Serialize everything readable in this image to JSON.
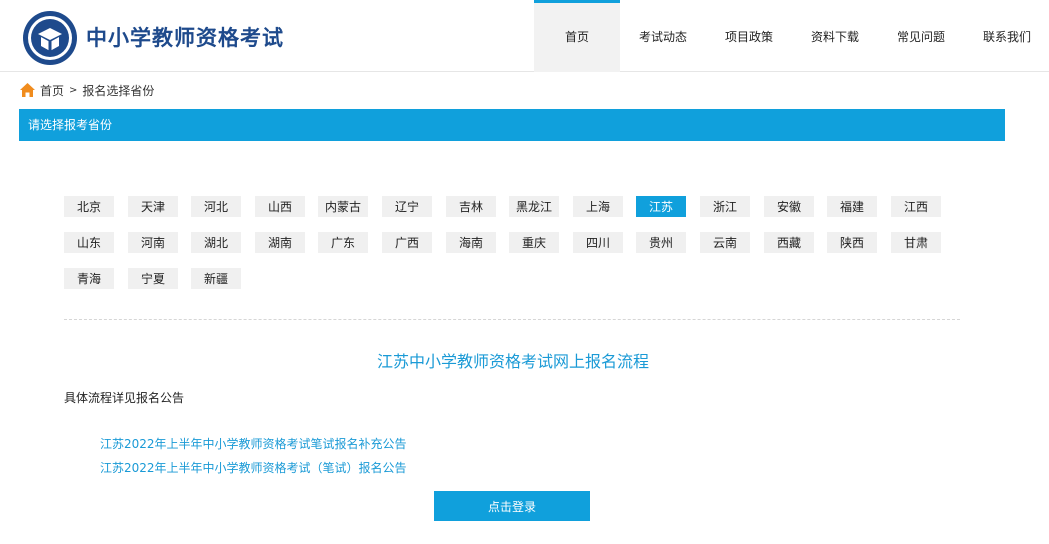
{
  "header": {
    "site_title": "中小学教师资格考试",
    "nav": [
      "首页",
      "考试动态",
      "项目政策",
      "资料下载",
      "常见问题",
      "联系我们"
    ],
    "active_nav": 0
  },
  "breadcrumb": {
    "home_icon": "home-icon",
    "home": "首页",
    "separator": ">",
    "current": "报名选择省份"
  },
  "section_title": "请选择报考省份",
  "provinces": [
    "北京",
    "天津",
    "河北",
    "山西",
    "内蒙古",
    "辽宁",
    "吉林",
    "黑龙江",
    "上海",
    "江苏",
    "浙江",
    "安徽",
    "福建",
    "江西",
    "山东",
    "河南",
    "湖北",
    "湖南",
    "广东",
    "广西",
    "海南",
    "重庆",
    "四川",
    "贵州",
    "云南",
    "西藏",
    "陕西",
    "甘肃",
    "青海",
    "宁夏",
    "新疆"
  ],
  "selected_province": "江苏",
  "flow": {
    "title": "江苏中小学教师资格考试网上报名流程",
    "detail": "具体流程详见报名公告",
    "links": [
      "江苏2022年上半年中小学教师资格考试笔试报名补充公告",
      "江苏2022年上半年中小学教师资格考试（笔试）报名公告"
    ],
    "login_button": "点击登录"
  },
  "colors": {
    "accent": "#10a0dc",
    "title_blue": "#1e4a8c",
    "link": "#1a9ad6"
  }
}
